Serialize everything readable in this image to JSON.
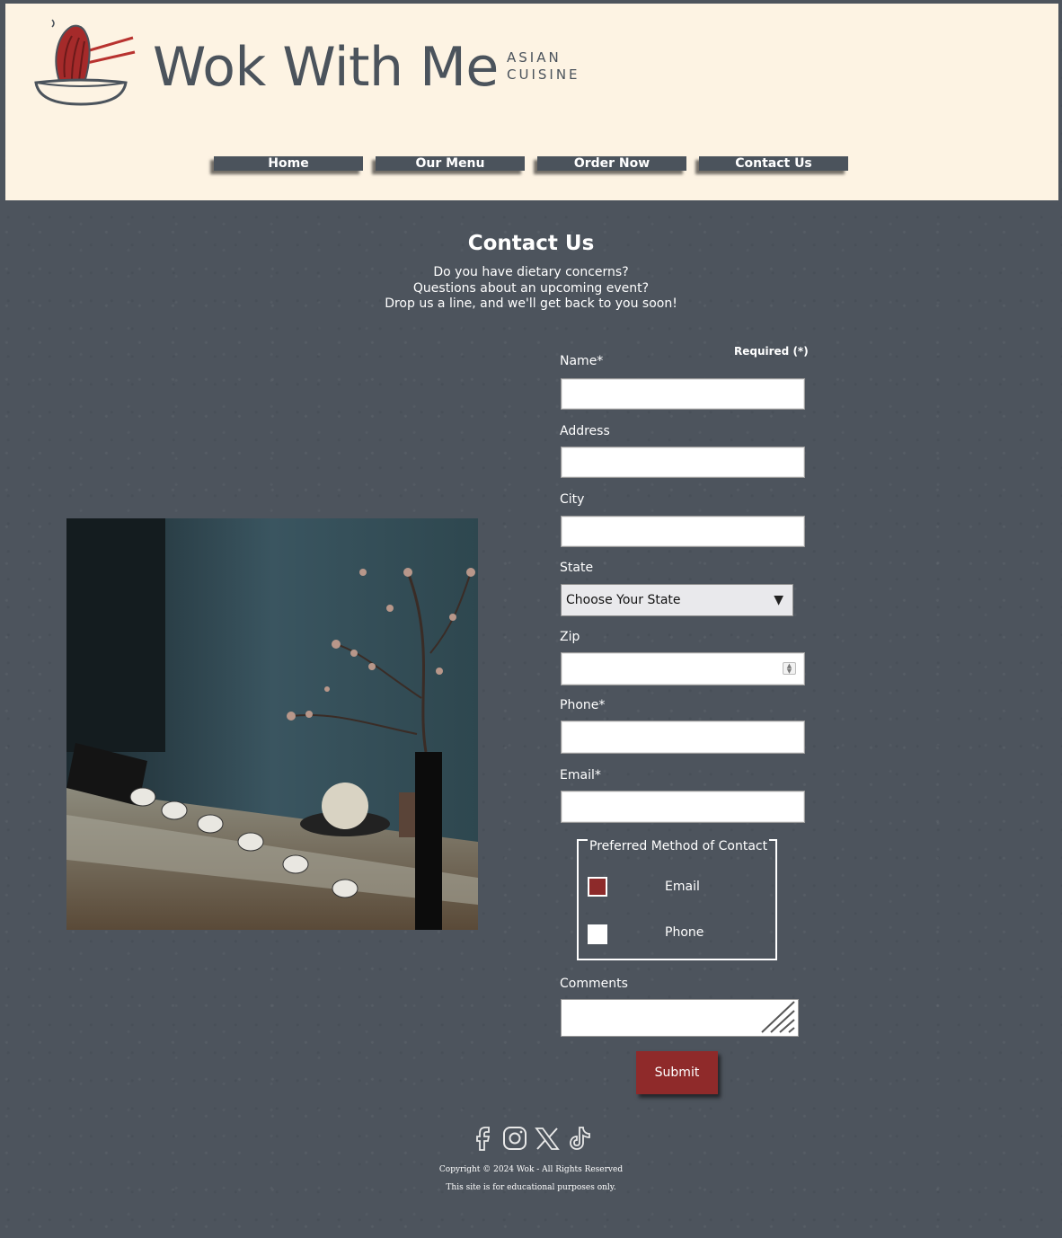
{
  "brand": {
    "name": "Wok With Me",
    "tagline_line1": "ASIAN",
    "tagline_line2": "CUISINE",
    "logo_icon": "noodle-bowl-chopsticks-icon"
  },
  "nav": {
    "items": [
      {
        "label": "Home"
      },
      {
        "label": "Our Menu"
      },
      {
        "label": "Order Now"
      },
      {
        "label": "Contact Us"
      }
    ]
  },
  "page": {
    "title": "Contact Us",
    "intro": [
      "Do you have dietary concerns?",
      "Questions about an upcoming event?",
      "Drop us a line, and we'll get back to you soon!"
    ]
  },
  "form": {
    "required_note": "Required (*)",
    "name_label": "Name*",
    "address_label": "Address",
    "city_label": "City",
    "state_label": "State",
    "state_value": "Choose Your State",
    "zip_label": "Zip",
    "phone_label": "Phone*",
    "email_label": "Email*",
    "preferred": {
      "legend": "Preferred Method of Contact",
      "options": [
        {
          "label": "Email",
          "checked": true
        },
        {
          "label": "Phone",
          "checked": false
        }
      ]
    },
    "comments_label": "Comments",
    "submit_label": "Submit"
  },
  "social": [
    "facebook-icon",
    "instagram-icon",
    "x-icon",
    "tiktok-icon"
  ],
  "footer": {
    "copyright": "Copyright © 2024 Wok - All Rights Reserved",
    "note": "This site is for educational purposes only."
  },
  "colors": {
    "header_bg": "#fdf3e3",
    "brand_text": "#4b535c",
    "accent_red": "#8f2a2a",
    "page_bg": "#4d545d"
  }
}
